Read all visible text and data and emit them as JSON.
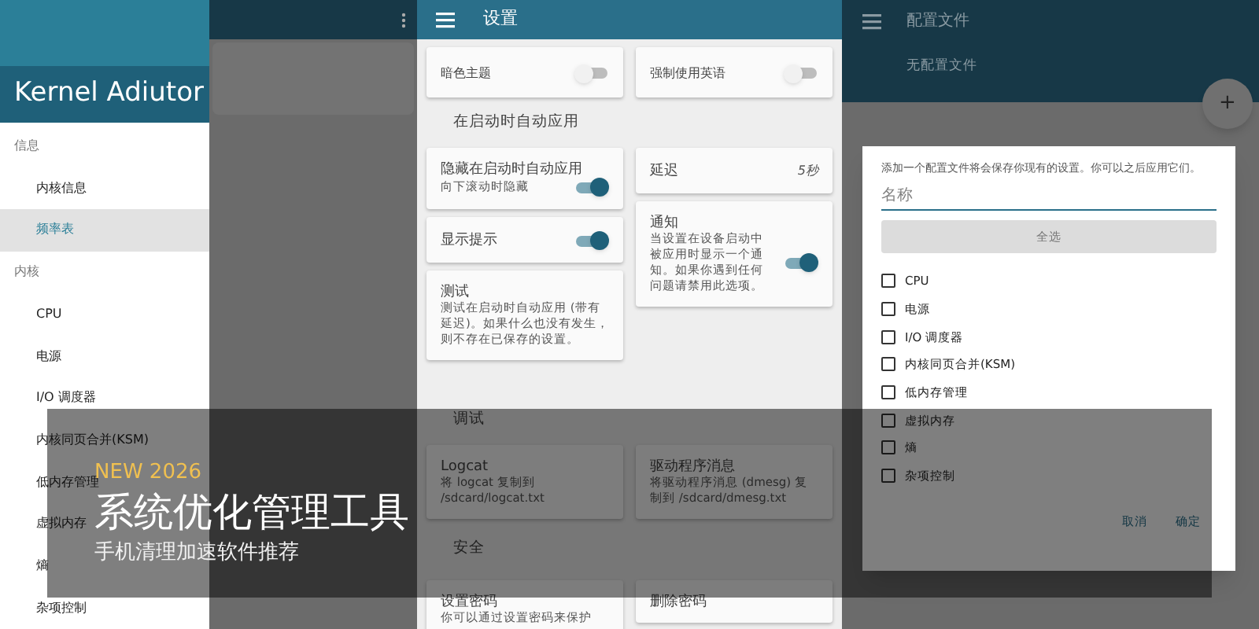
{
  "drawer": {
    "title": "Kernel Adiutor",
    "items": [
      {
        "kind": "header",
        "label": "信息"
      },
      {
        "kind": "item",
        "label": "内核信息",
        "selected": false
      },
      {
        "kind": "item",
        "label": "频率表",
        "selected": true
      },
      {
        "kind": "header",
        "label": "内核"
      },
      {
        "kind": "item",
        "label": "CPU",
        "selected": false
      },
      {
        "kind": "item",
        "label": "电源",
        "selected": false
      },
      {
        "kind": "item",
        "label": "I/O 调度器",
        "selected": false
      },
      {
        "kind": "item",
        "label": "内核同页合并(KSM)",
        "selected": false
      },
      {
        "kind": "item",
        "label": "低内存管理",
        "selected": false
      },
      {
        "kind": "item",
        "label": "虚拟内存",
        "selected": false
      },
      {
        "kind": "item",
        "label": "熵",
        "selected": false
      },
      {
        "kind": "item",
        "label": "杂项控制",
        "selected": false
      }
    ]
  },
  "settings": {
    "title": "设置",
    "top": [
      {
        "label": "暗色主题",
        "on": false
      },
      {
        "label": "强制使用英语",
        "on": false
      }
    ],
    "sections": [
      {
        "title": "在启动时自动应用",
        "left": [
          {
            "title": "隐藏在启动时自动应用",
            "description": "向下滚动时隐藏",
            "on": true
          },
          {
            "title": "显示提示",
            "on": true
          },
          {
            "title": "测试",
            "description": "测试在启动时自动应用 (带有延迟)。如果什么也没有发生，则不存在已保存的设置。"
          }
        ],
        "right": [
          {
            "title": "延迟",
            "value": "5秒"
          },
          {
            "title": "通知",
            "description": "当设置在设备启动中被应用时显示一个通知。如果你遇到任何问题请禁用此选项。",
            "on": true
          }
        ]
      },
      {
        "title": "调试",
        "left": [
          {
            "title": "Logcat",
            "description": "将 logcat 复制到 /sdcard/logcat.txt"
          }
        ],
        "right": [
          {
            "title": "驱动程序消息",
            "description": "将驱动程序消息 (dmesg) 复制到 /sdcard/dmesg.txt"
          }
        ]
      },
      {
        "title": "安全",
        "left": [
          {
            "title": "设置密码",
            "description": "你可以通过设置密码来保护"
          }
        ],
        "right": [
          {
            "title": "删除密码"
          }
        ]
      }
    ]
  },
  "profiles": {
    "title": "配置文件",
    "empty": "无配置文件",
    "fab": "+",
    "dialog": {
      "message": "添加一个配置文件将会保存你现有的设置。你可以之后应用它们。",
      "placeholder": "名称",
      "select_all": "全选",
      "options": [
        {
          "label": "CPU",
          "checked": false
        },
        {
          "label": "电源",
          "checked": false
        },
        {
          "label": "I/O 调度器",
          "checked": false
        },
        {
          "label": "内核同页合并(KSM)",
          "checked": false
        },
        {
          "label": "低内存管理",
          "checked": false
        },
        {
          "label": "虚拟内存",
          "checked": false
        },
        {
          "label": "熵",
          "checked": false
        },
        {
          "label": "杂项控制",
          "checked": false
        }
      ],
      "buttons": [
        "取消",
        "确定"
      ]
    }
  },
  "banner": {
    "tag": "NEW 2026",
    "title": "系统优化管理工具",
    "subtitle": "手机清理加速软件推荐"
  }
}
